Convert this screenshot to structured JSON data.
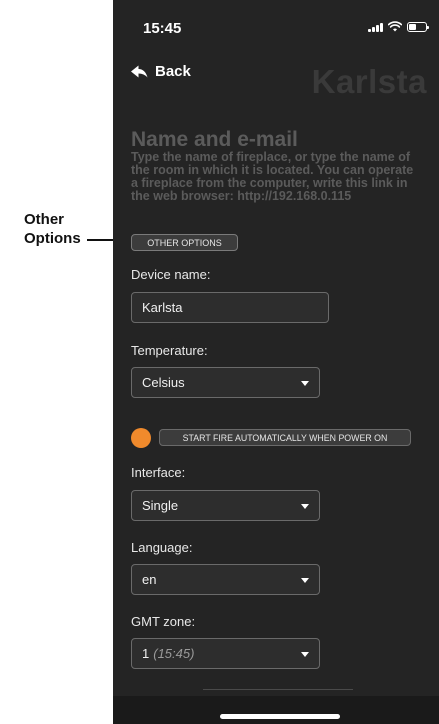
{
  "annotation": {
    "text_line1": "Other",
    "text_line2": "Options"
  },
  "status_bar": {
    "time": "15:45"
  },
  "nav": {
    "back_label": "Back",
    "device_title": "Karlsta"
  },
  "section": {
    "title": "Name and e-mail",
    "description": "Type the name of fireplace, or type the name of the room in which it is located. You can operate a fireplace from the computer, write this link in the web browser: http://192.168.0.115"
  },
  "other_options_button": "OTHER OPTIONS",
  "device_name": {
    "label": "Device name:",
    "value": "Karlsta"
  },
  "temperature": {
    "label": "Temperature:",
    "value": "Celsius"
  },
  "auto_start": {
    "label": "START FIRE AUTOMATICALLY WHEN POWER ON",
    "toggle_color": "#f08a2c"
  },
  "interface": {
    "label": "Interface:",
    "value": "Single"
  },
  "language": {
    "label": "Language:",
    "value": "en"
  },
  "gmt_zone": {
    "label": "GMT zone:",
    "value": "1",
    "hint": "(15:45)"
  },
  "colors": {
    "background": "#242424",
    "accent": "#f08a2c"
  }
}
